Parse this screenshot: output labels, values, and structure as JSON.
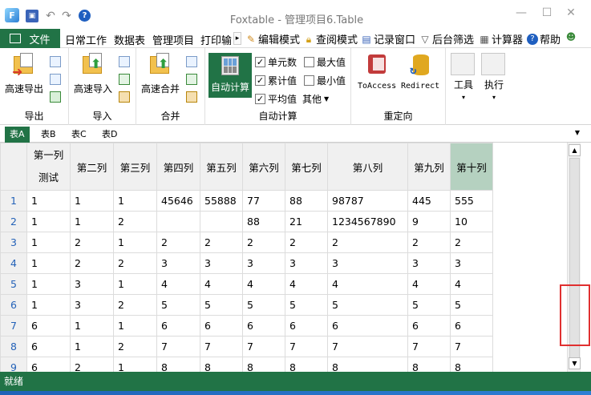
{
  "window": {
    "title": "Foxtable - 管理项目6.Table"
  },
  "menu": {
    "file_label": "文件",
    "items": [
      "日常工作",
      "数据表",
      "管理项目",
      "打印输出"
    ],
    "tools": [
      {
        "label": "编辑模式",
        "icon": "pencil-icon"
      },
      {
        "label": "查阅模式",
        "icon": "lock-icon"
      },
      {
        "label": "记录窗口",
        "icon": "window-icon"
      },
      {
        "label": "后台筛选",
        "icon": "filter-icon"
      },
      {
        "label": "计算器",
        "icon": "calculator-icon"
      },
      {
        "label": "帮助",
        "icon": "help-icon"
      }
    ]
  },
  "ribbon": {
    "export": {
      "button": "高速导出",
      "group": "导出"
    },
    "import": {
      "button": "高速导入",
      "group": "导入"
    },
    "merge": {
      "button": "高速合并",
      "group": "合并"
    },
    "autocalc": {
      "button": "自动计算",
      "group": "自动计算",
      "options": [
        {
          "label": "单元数",
          "checked": true
        },
        {
          "label": "最大值",
          "checked": false
        },
        {
          "label": "累计值",
          "checked": true
        },
        {
          "label": "最小值",
          "checked": false
        },
        {
          "label": "平均值",
          "checked": true
        }
      ],
      "other_label": "其他"
    },
    "redirect": {
      "toaccess": "ToAccess",
      "redirect": "Redirect",
      "group": "重定向"
    },
    "tools_btn": "工具",
    "exec_btn": "执行"
  },
  "tabs": [
    "表A",
    "表B",
    "表C",
    "表D"
  ],
  "grid": {
    "col1_lines": [
      "第一列",
      "测试"
    ],
    "columns": [
      "第二列",
      "第三列",
      "第四列",
      "第五列",
      "第六列",
      "第七列",
      "第八列",
      "第九列",
      "第十列"
    ],
    "rows": [
      {
        "n": "1",
        "cells": [
          "1",
          "1",
          "1",
          "45646",
          "55888",
          "77",
          "88",
          "98787",
          "445",
          "555"
        ]
      },
      {
        "n": "2",
        "cells": [
          "1",
          "1",
          "2",
          "",
          "",
          "88",
          "21",
          "1234567890",
          "9",
          "10"
        ]
      },
      {
        "n": "3",
        "cells": [
          "1",
          "2",
          "1",
          "2",
          "2",
          "2",
          "2",
          "2",
          "2",
          "2"
        ]
      },
      {
        "n": "4",
        "cells": [
          "1",
          "2",
          "2",
          "3",
          "3",
          "3",
          "3",
          "3",
          "3",
          "3"
        ]
      },
      {
        "n": "5",
        "cells": [
          "1",
          "3",
          "1",
          "4",
          "4",
          "4",
          "4",
          "4",
          "4",
          "4"
        ]
      },
      {
        "n": "6",
        "cells": [
          "1",
          "3",
          "2",
          "5",
          "5",
          "5",
          "5",
          "5",
          "5",
          "5"
        ]
      },
      {
        "n": "7",
        "cells": [
          "6",
          "1",
          "1",
          "6",
          "6",
          "6",
          "6",
          "6",
          "6",
          "6"
        ]
      },
      {
        "n": "8",
        "cells": [
          "6",
          "1",
          "2",
          "7",
          "7",
          "7",
          "7",
          "7",
          "7",
          "7"
        ]
      },
      {
        "n": "9",
        "cells": [
          "6",
          "2",
          "1",
          "8",
          "8",
          "8",
          "8",
          "8",
          "8",
          "8"
        ]
      }
    ]
  },
  "status": {
    "text": "就绪"
  },
  "accent_color": "#217346"
}
